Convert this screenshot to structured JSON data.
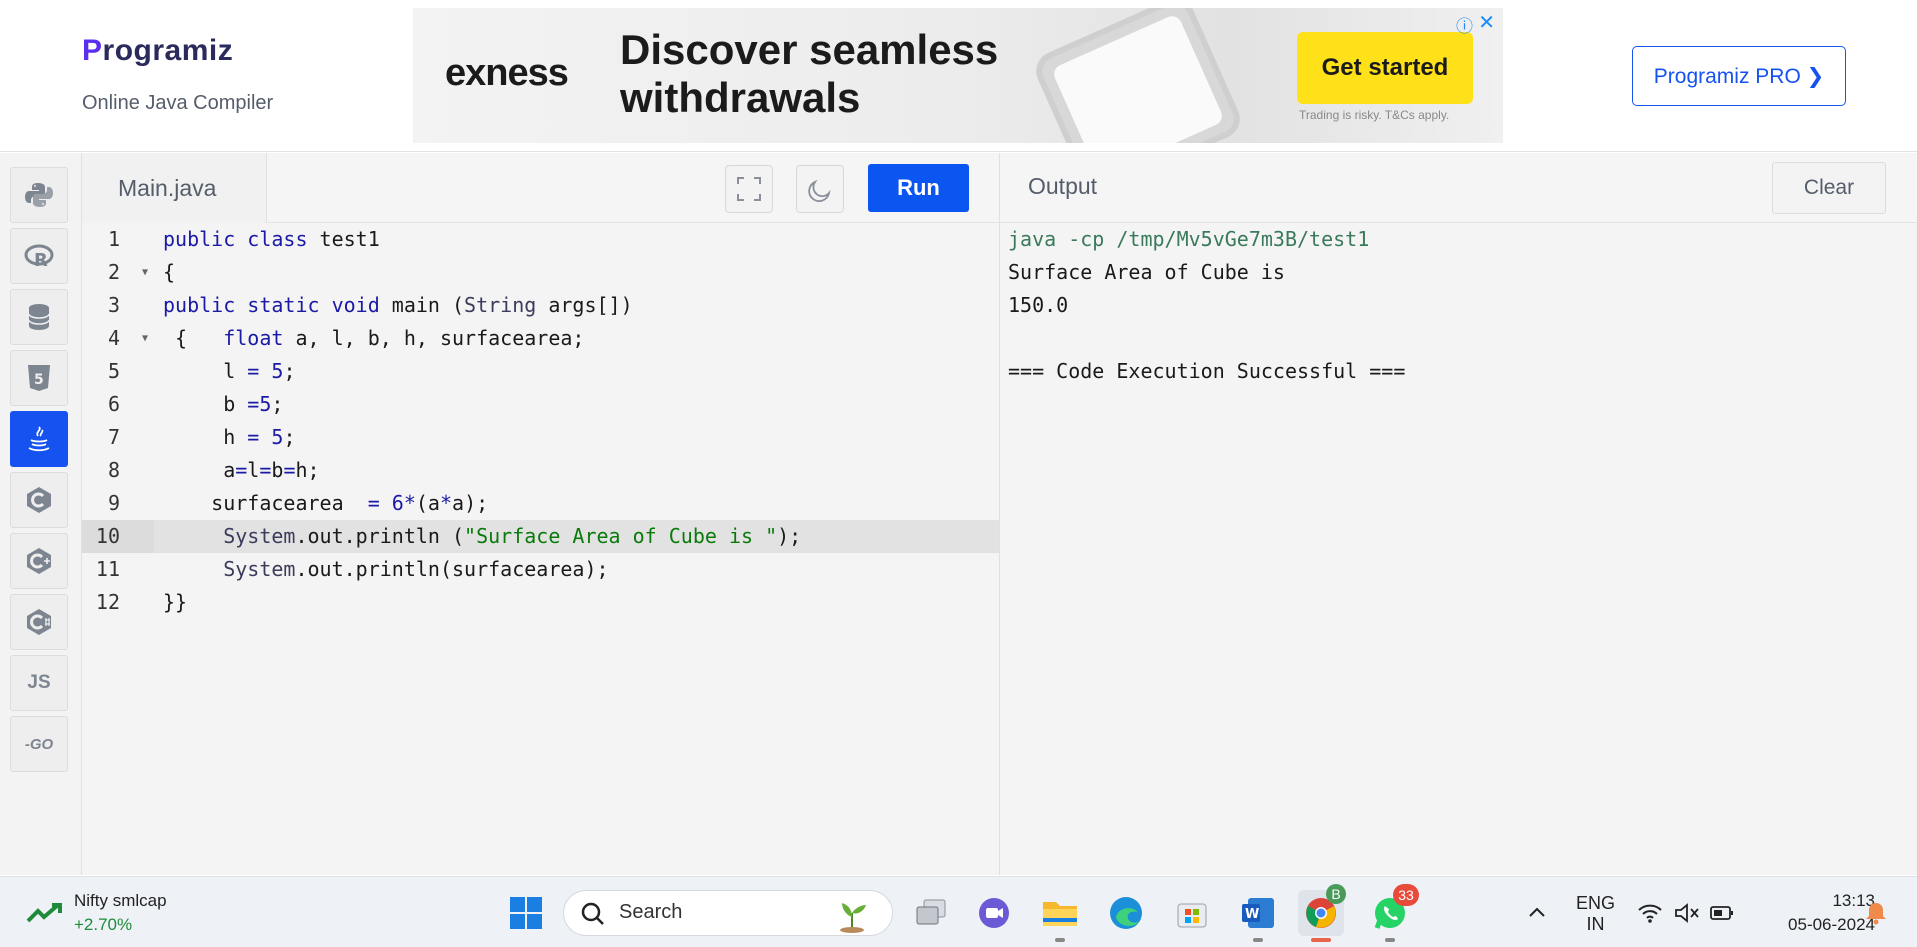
{
  "header": {
    "logo_prefix": "P",
    "logo_rest": "rogramiz",
    "subtitle": "Online Java Compiler",
    "pro_button": "Programiz PRO ❯"
  },
  "ad": {
    "brand": "exness",
    "headline": "Discover seamless withdrawals",
    "cta": "Get started",
    "disclaimer": "Trading is risky. T&Cs apply.",
    "info_icon": "ⓘ",
    "close_icon": "✕"
  },
  "sidebar": {
    "items": [
      {
        "name": "python",
        "label": ""
      },
      {
        "name": "r",
        "label": ""
      },
      {
        "name": "sql",
        "label": ""
      },
      {
        "name": "html",
        "label": ""
      },
      {
        "name": "java",
        "label": "",
        "active": true
      },
      {
        "name": "c",
        "label": ""
      },
      {
        "name": "cpp",
        "label": ""
      },
      {
        "name": "csharp",
        "label": ""
      },
      {
        "name": "js",
        "label": "JS"
      },
      {
        "name": "go",
        "label": "-GO"
      }
    ]
  },
  "editor": {
    "tab_label": "Main.java",
    "run_label": "Run",
    "highlight_line": 10,
    "lines": [
      {
        "n": "1",
        "text": "public class test1"
      },
      {
        "n": "2",
        "text": "{"
      },
      {
        "n": "3",
        "text": "public static void main (String args[])"
      },
      {
        "n": "4",
        "text": " {   float a, l, b, h, surfacearea;"
      },
      {
        "n": "5",
        "text": "     l = 5;"
      },
      {
        "n": "6",
        "text": "     b =5;"
      },
      {
        "n": "7",
        "text": "     h = 5;"
      },
      {
        "n": "8",
        "text": "     a=l=b=h;"
      },
      {
        "n": "9",
        "text": "    surfacearea  = 6*(a*a);"
      },
      {
        "n": "10",
        "text": "     System.out.println (\"Surface Area of Cube is \");"
      },
      {
        "n": "11",
        "text": "     System.out.println(surfacearea);"
      },
      {
        "n": "12",
        "text": "}}"
      }
    ]
  },
  "output": {
    "title": "Output",
    "clear_label": "Clear",
    "lines": [
      "java -cp /tmp/Mv5vGe7m3B/test1",
      "Surface Area of Cube is ",
      "150.0",
      "",
      "=== Code Execution Successful ==="
    ]
  },
  "taskbar": {
    "stock_name": "Nifty smlcap",
    "stock_change": "+2.70%",
    "search_label": "Search",
    "whatsapp_badge": "33",
    "chrome_badge": "B",
    "lang_line1": "ENG",
    "lang_line2": "IN",
    "time": "13:13",
    "date": "05-06-2024"
  },
  "colors": {
    "accent": "#0b56f0",
    "editor_bg": "#f4f4f4",
    "taskbar_bg": "#eef2f7"
  }
}
